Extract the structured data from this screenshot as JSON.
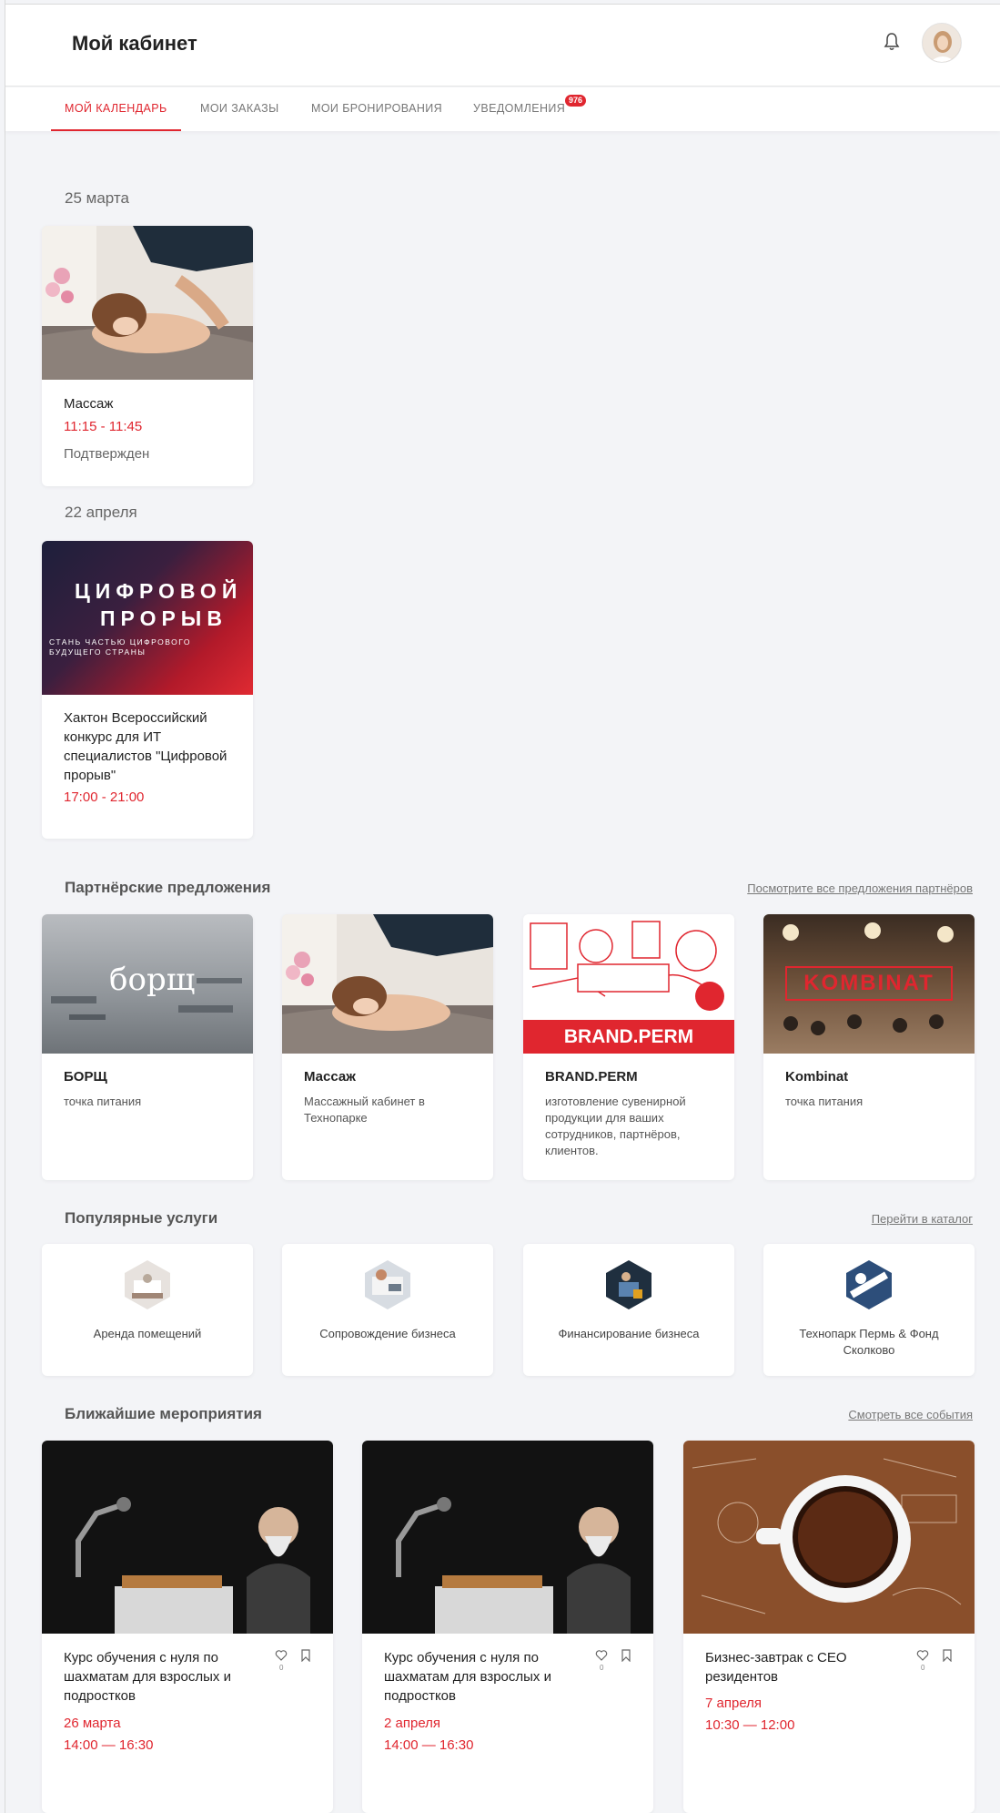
{
  "header": {
    "title": "Мой кабинет"
  },
  "tabs": [
    {
      "label": "Мой календарь"
    },
    {
      "label": "Мои заказы"
    },
    {
      "label": "Мои бронирования"
    },
    {
      "label": "Уведомления",
      "badge": "976"
    }
  ],
  "calendar": [
    {
      "date": "25 марта",
      "title": "Массаж",
      "time": "11:15 - 11:45",
      "status": "Подтвержден"
    },
    {
      "date": "22 апреля",
      "title": "Хактон Всероссийский конкурс для ИТ специалистов \"Цифровой прорыв\"",
      "time": "17:00 - 21:00",
      "image_text": [
        "ЦИФРОВОЙ",
        "ПРОРЫВ",
        "СТАНЬ ЧАСТЬЮ ЦИФРОВОГО",
        "БУДУЩЕГО СТРАНЫ"
      ]
    }
  ],
  "partners": {
    "title": "Партнёрские предложения",
    "link": "Посмотрите все предложения партнёров",
    "items": [
      {
        "title": "БОРЩ",
        "desc": "точка питания",
        "image_text": "борщ"
      },
      {
        "title": "Массаж",
        "desc": "Массажный кабинет в Технопарке"
      },
      {
        "title": "BRAND.PERM",
        "desc": "изготовление сувенирной продукции для ваших сотрудников, партнёров, клиентов.",
        "image_text": "BRAND.PERM"
      },
      {
        "title": "Kombinat",
        "desc": "точка питания",
        "image_text": "KOMBINAT"
      }
    ]
  },
  "services": {
    "title": "Популярные услуги",
    "link": "Перейти в каталог",
    "items": [
      {
        "label": "Аренда помещений"
      },
      {
        "label": "Сопровождение бизнеса"
      },
      {
        "label": "Финансирование бизнеса"
      },
      {
        "label": "Технопарк Пермь & Фонд Сколково"
      }
    ]
  },
  "events": {
    "title": "Ближайшие мероприятия",
    "link": "Смотреть все события",
    "items": [
      {
        "title": "Курс обучения с нуля по шахматам для взрослых и подростков",
        "date": "26 марта",
        "time": "14:00 — 16:30",
        "likes": "0"
      },
      {
        "title": "Курс обучения с нуля по шахматам для взрослых и подростков",
        "date": "2 апреля",
        "time": "14:00 — 16:30",
        "likes": "0"
      },
      {
        "title": "Бизнес-завтрак с CEO резидентов",
        "date": "7 апреля",
        "time": "10:30 — 12:00",
        "likes": "0"
      }
    ]
  },
  "colors": {
    "accent": "#e0262f",
    "background": "#f3f4f7"
  }
}
